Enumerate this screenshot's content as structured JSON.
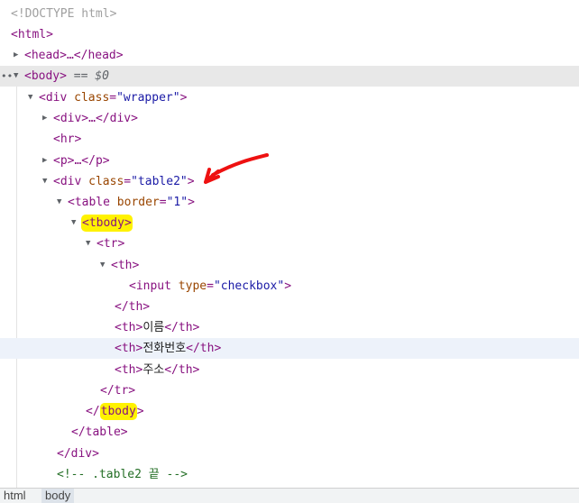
{
  "dom": {
    "doctype": "<!DOCTYPE html>",
    "html_open": "<html>",
    "head_collapsed": "<head>…</head>",
    "body_open": "<body>",
    "selected_marker": "== $0",
    "ellipsis": "…",
    "div_wrapper": {
      "tag_start": "<div",
      "attr_name": "class",
      "attr_value": "\"wrapper\"",
      "tag_end": ">"
    },
    "div_collapsed": "<div>…</div>",
    "hr": "<hr>",
    "p_collapsed": "<p>…</p>",
    "div_table2": {
      "tag_start": "<div",
      "attr_name": "class",
      "attr_value": "\"table2\"",
      "tag_end": ">"
    },
    "table": {
      "tag_start": "<table",
      "attr_name": "border",
      "attr_value": "\"1\"",
      "tag_end": ">"
    },
    "tbody_open": "<tbody>",
    "tr_open": "<tr>",
    "th_open": "<th>",
    "input": {
      "tag_start": "<input",
      "attr_name": "type",
      "attr_value": "\"checkbox\"",
      "tag_end": ">"
    },
    "th_close": "</th>",
    "th_name": "이름",
    "th_phone": "전화번호",
    "th_address": "주소",
    "tr_close": "</tr>",
    "tbody_close_lt": "</",
    "tbody_close_name": "tbody",
    "tbody_close_gt": ">",
    "table_close": "</table>",
    "div_close": "</div>",
    "comment": "<!-- .table2 끝 -->"
  },
  "breadcrumb": {
    "items": [
      "html",
      "body"
    ],
    "active": "body"
  },
  "colors": {
    "tag": "#881280",
    "attr_name": "#994500",
    "attr_value": "#1a1aa6",
    "comment": "#236e25",
    "highlight": "#fff200",
    "annotation_arrow": "#ee1111",
    "selected_row": "#e8e8e8",
    "hover_row": "#edf2fa"
  },
  "icons": [
    "triangle-expanded-icon",
    "triangle-collapsed-icon",
    "more-dots-icon",
    "red-arrow-annotation"
  ]
}
